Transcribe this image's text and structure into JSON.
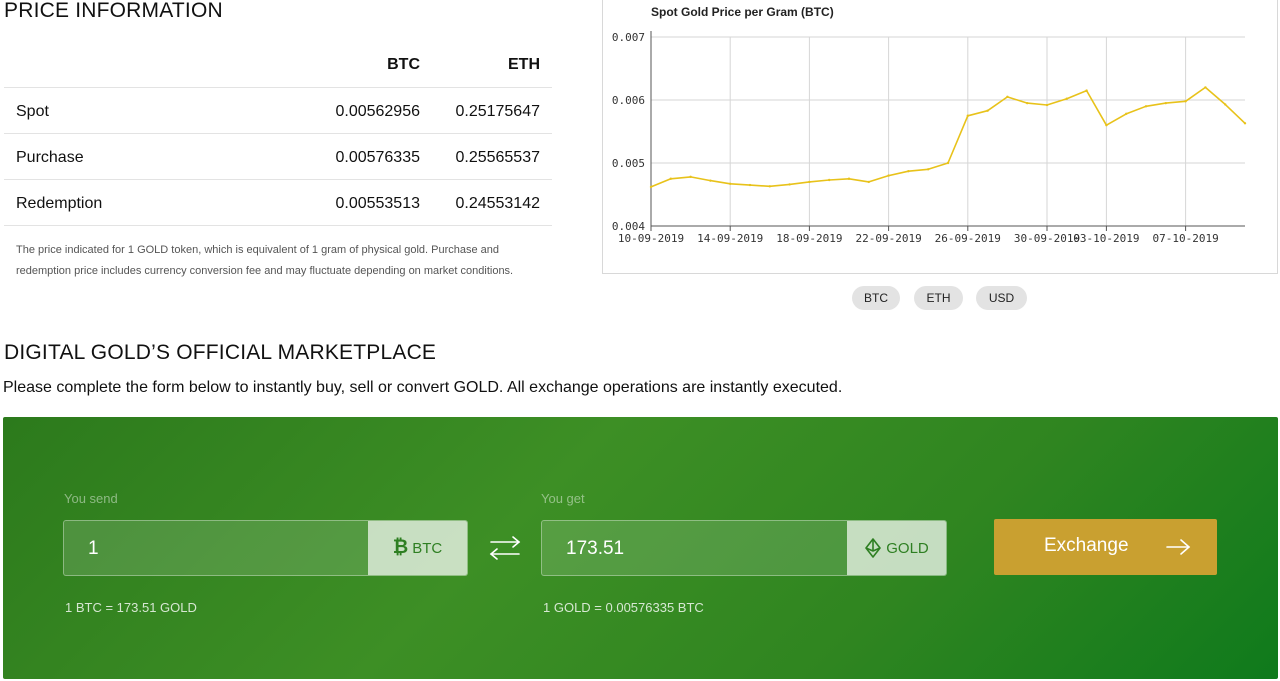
{
  "price_info": {
    "title": "PRICE INFORMATION",
    "columns": [
      "BTC",
      "ETH"
    ],
    "rows": [
      {
        "label": "Spot",
        "btc": "0.00562956",
        "eth": "0.25175647"
      },
      {
        "label": "Purchase",
        "btc": "0.00576335",
        "eth": "0.25565537"
      },
      {
        "label": "Redemption",
        "btc": "0.00553513",
        "eth": "0.24553142"
      }
    ],
    "note": "The price indicated for 1 GOLD token, which is equivalent of 1 gram of physical gold. Purchase and redemption price includes currency conversion fee and may fluctuate depending on market conditions."
  },
  "chart_data": {
    "type": "line",
    "title": "Spot Gold Price per Gram (BTC)",
    "xlabel": "",
    "ylabel": "",
    "ylim": [
      0.004,
      0.007
    ],
    "y_ticks": [
      "0.007",
      "0.006",
      "0.005",
      "0.004"
    ],
    "x_ticks": [
      "10-09-2019",
      "14-09-2019",
      "18-09-2019",
      "22-09-2019",
      "26-09-2019",
      "30-09-2019",
      "03-10-2019",
      "07-10-2019"
    ],
    "grid": true,
    "color": "#e8c21a",
    "series": [
      {
        "name": "",
        "x": [
          "10-09-2019",
          "11-09-2019",
          "12-09-2019",
          "13-09-2019",
          "14-09-2019",
          "15-09-2019",
          "16-09-2019",
          "17-09-2019",
          "18-09-2019",
          "19-09-2019",
          "20-09-2019",
          "21-09-2019",
          "22-09-2019",
          "23-09-2019",
          "24-09-2019",
          "25-09-2019",
          "26-09-2019",
          "27-09-2019",
          "28-09-2019",
          "29-09-2019",
          "30-09-2019",
          "01-10-2019",
          "02-10-2019",
          "03-10-2019",
          "04-10-2019",
          "05-10-2019",
          "06-10-2019",
          "07-10-2019",
          "08-10-2019",
          "09-10-2019",
          "10-10-2019"
        ],
        "values": [
          0.00462,
          0.00475,
          0.00478,
          0.00472,
          0.00467,
          0.00465,
          0.00463,
          0.00466,
          0.0047,
          0.00473,
          0.00475,
          0.0047,
          0.0048,
          0.00487,
          0.0049,
          0.005,
          0.00575,
          0.00583,
          0.00605,
          0.00595,
          0.00592,
          0.00602,
          0.00615,
          0.0056,
          0.00578,
          0.0059,
          0.00595,
          0.00598,
          0.0062,
          0.00593,
          0.00563
        ]
      }
    ]
  },
  "currency_buttons": [
    "BTC",
    "ETH",
    "USD"
  ],
  "marketplace": {
    "title": "DIGITAL GOLD’S OFFICIAL MARKETPLACE",
    "subtitle": "Please complete the form below to instantly buy, sell or convert GOLD. All exchange operations are instantly executed.",
    "send": {
      "label": "You send",
      "value": "1",
      "currency": "BTC",
      "icon": "bitcoin-icon",
      "rate": "1 BTC = 173.51 GOLD"
    },
    "get": {
      "label": "You get",
      "value": "173.51",
      "currency": "GOLD",
      "icon": "gold-diamond-icon",
      "rate": "1 GOLD = 0.00576335 BTC"
    },
    "button": {
      "label": "Exchange",
      "icon": "arrow-right-icon"
    },
    "accent": "#c9a030",
    "panel_color": "#2f8520"
  }
}
